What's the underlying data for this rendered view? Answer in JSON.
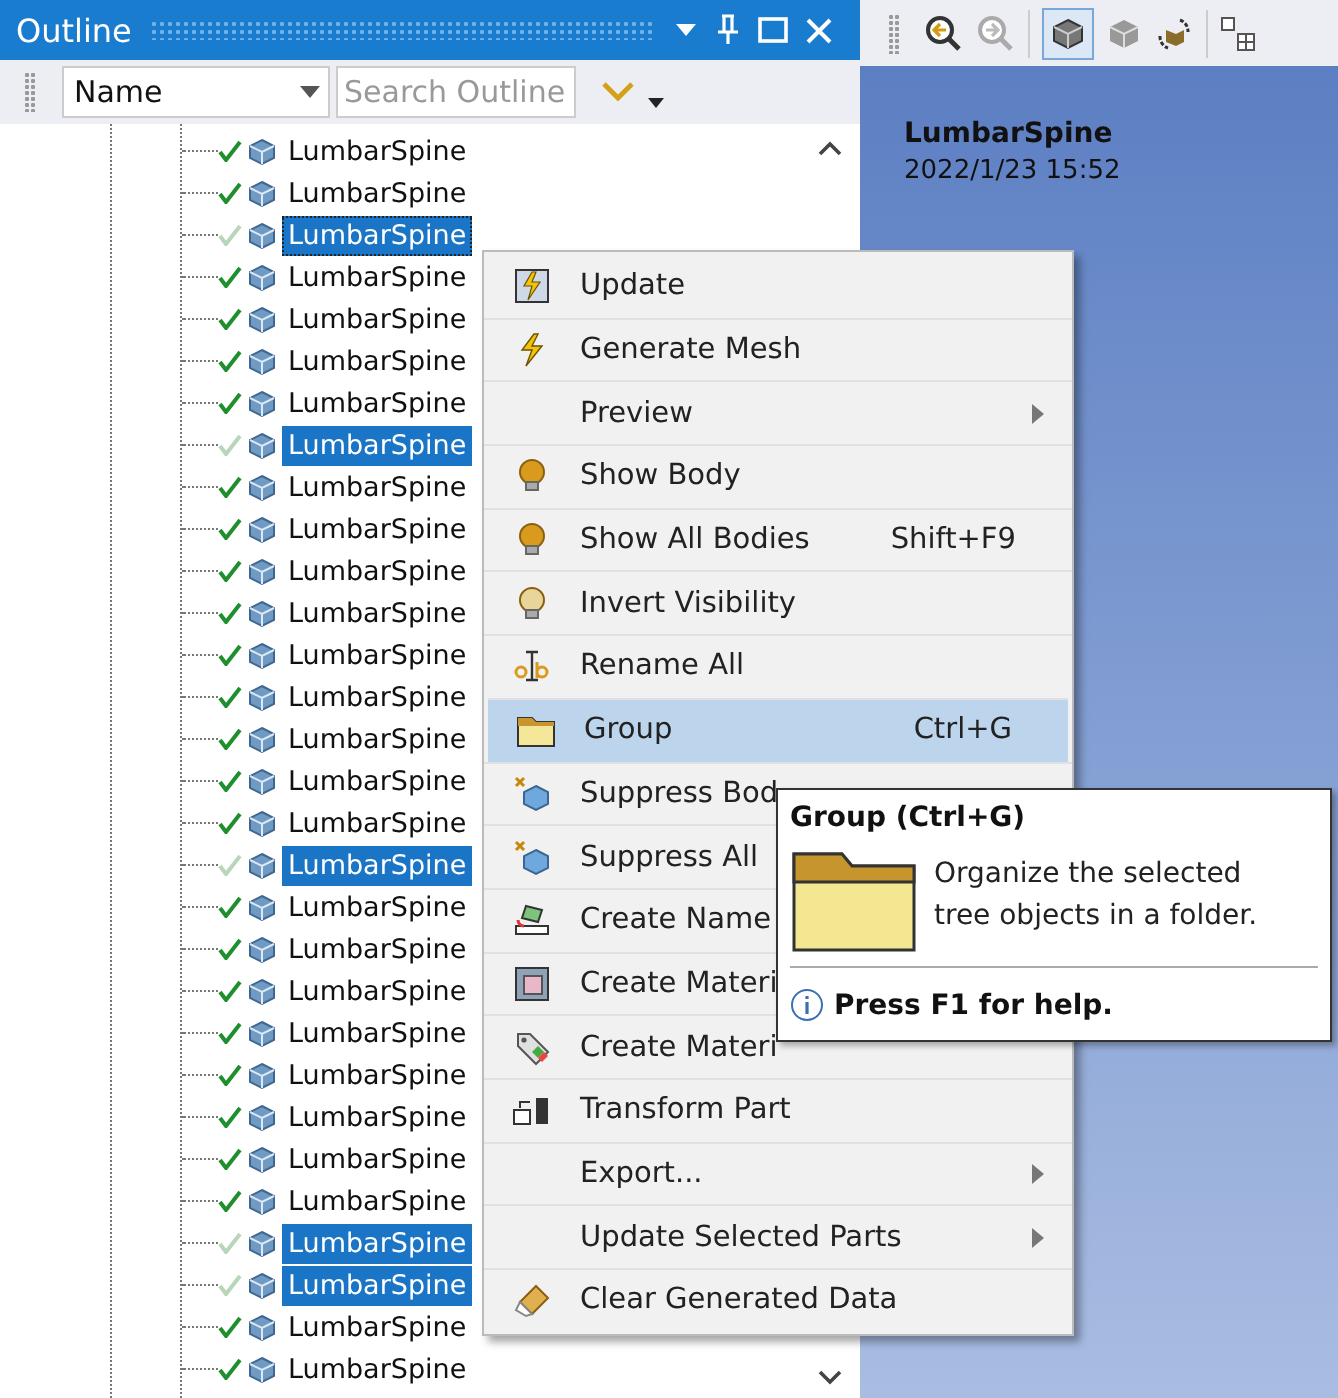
{
  "panel": {
    "title": "Outline"
  },
  "filter": {
    "value": "Name",
    "placeholder": "Search Outline"
  },
  "tree": {
    "rows": [
      {
        "label": "LumbarSpine",
        "selected": false,
        "focused": false
      },
      {
        "label": "LumbarSpine",
        "selected": false,
        "focused": false
      },
      {
        "label": "LumbarSpine",
        "selected": true,
        "focused": true
      },
      {
        "label": "LumbarSpine",
        "selected": false,
        "focused": false
      },
      {
        "label": "LumbarSpine",
        "selected": false,
        "focused": false
      },
      {
        "label": "LumbarSpine",
        "selected": false,
        "focused": false
      },
      {
        "label": "LumbarSpine",
        "selected": false,
        "focused": false
      },
      {
        "label": "LumbarSpine",
        "selected": true,
        "focused": false
      },
      {
        "label": "LumbarSpine",
        "selected": false,
        "focused": false
      },
      {
        "label": "LumbarSpine",
        "selected": false,
        "focused": false
      },
      {
        "label": "LumbarSpine",
        "selected": false,
        "focused": false
      },
      {
        "label": "LumbarSpine",
        "selected": false,
        "focused": false
      },
      {
        "label": "LumbarSpine",
        "selected": false,
        "focused": false
      },
      {
        "label": "LumbarSpine",
        "selected": false,
        "focused": false
      },
      {
        "label": "LumbarSpine",
        "selected": false,
        "focused": false
      },
      {
        "label": "LumbarSpine",
        "selected": false,
        "focused": false
      },
      {
        "label": "LumbarSpine",
        "selected": false,
        "focused": false
      },
      {
        "label": "LumbarSpine",
        "selected": true,
        "focused": false
      },
      {
        "label": "LumbarSpine",
        "selected": false,
        "focused": false
      },
      {
        "label": "LumbarSpine",
        "selected": false,
        "focused": false
      },
      {
        "label": "LumbarSpine",
        "selected": false,
        "focused": false
      },
      {
        "label": "LumbarSpine",
        "selected": false,
        "focused": false
      },
      {
        "label": "LumbarSpine",
        "selected": false,
        "focused": false
      },
      {
        "label": "LumbarSpine",
        "selected": false,
        "focused": false
      },
      {
        "label": "LumbarSpine",
        "selected": false,
        "focused": false
      },
      {
        "label": "LumbarSpine",
        "selected": false,
        "focused": false
      },
      {
        "label": "LumbarSpine",
        "selected": true,
        "focused": false
      },
      {
        "label": "LumbarSpine",
        "selected": true,
        "focused": false
      },
      {
        "label": "LumbarSpine",
        "selected": false,
        "focused": false
      },
      {
        "label": "LumbarSpine",
        "selected": false,
        "focused": false
      }
    ]
  },
  "details": {
    "title": "LumbarSpine",
    "date": "2022/1/23 15:52"
  },
  "context_menu": {
    "items": [
      {
        "label": "Update",
        "selected": false
      },
      {
        "label": "Generate Mesh",
        "selected": false
      },
      {
        "label": "Preview",
        "submenu": true,
        "selected": false
      },
      {
        "label": "Show Body",
        "selected": false
      },
      {
        "label": "Show All Bodies",
        "shortcut": "Shift+F9",
        "selected": false
      },
      {
        "label": "Invert Visibility",
        "selected": false
      },
      {
        "label": "Rename All",
        "selected": false
      },
      {
        "label": "Group",
        "shortcut": "Ctrl+G",
        "selected": true
      },
      {
        "label": "Suppress Bod",
        "selected": false
      },
      {
        "label": "Suppress All",
        "selected": false
      },
      {
        "label": "Create Name",
        "selected": false
      },
      {
        "label": "Create Materi",
        "selected": false
      },
      {
        "label": "Create Materi",
        "selected": false
      },
      {
        "label": "Transform Part",
        "selected": false
      },
      {
        "label": "Export...",
        "submenu": true,
        "selected": false
      },
      {
        "label": "Update Selected Parts",
        "submenu": true,
        "selected": false
      },
      {
        "label": "Clear Generated Data",
        "selected": false
      }
    ]
  },
  "tooltip": {
    "title": "Group (Ctrl+G)",
    "description": "Organize the selected tree objects in a folder.",
    "help": "Press F1 for help."
  }
}
